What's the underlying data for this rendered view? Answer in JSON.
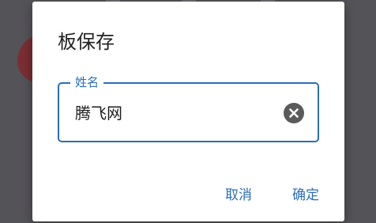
{
  "dialog": {
    "title": "板保存",
    "field": {
      "label": "姓名",
      "value": "腾飞网"
    },
    "clear_icon": "clear-circle-icon",
    "cancel_label": "取消",
    "ok_label": "确定"
  },
  "colors": {
    "accent": "#2a6ebb",
    "scrim": "#545358",
    "dialog_bg": "#ffffff",
    "clear_icon_bg": "#5a5a5a"
  }
}
